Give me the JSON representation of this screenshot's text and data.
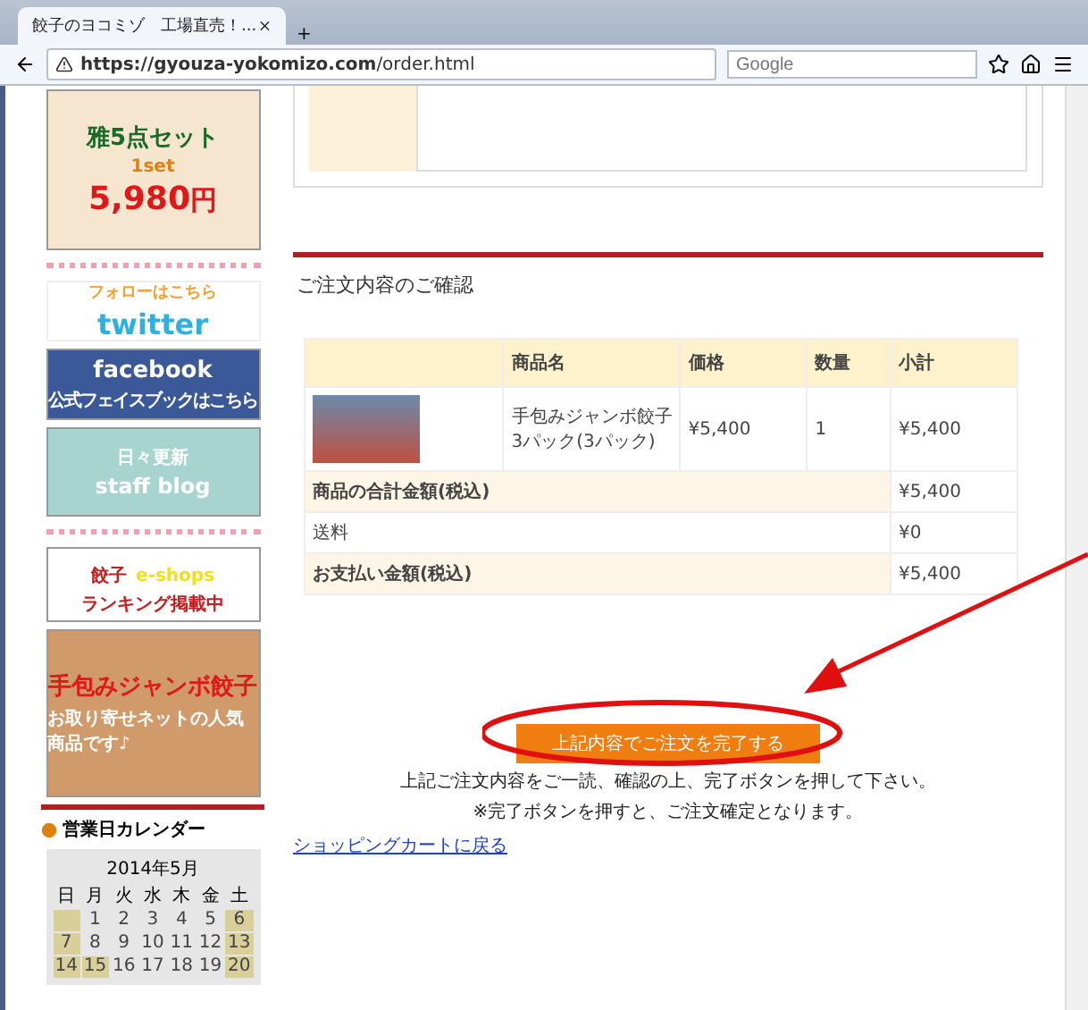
{
  "browser": {
    "tab_title": "餃子のヨコミゾ　工場直売！...",
    "new_tab": "+",
    "url_host": "https://gyouza-yokomizo.com",
    "url_path": "/order.html",
    "search_placeholder": "Google"
  },
  "sidebar": {
    "set_banner": {
      "title": "雅5点セット",
      "badge": "1set",
      "price": "5,980",
      "unit": "円"
    },
    "twitter": {
      "caption": "フォローはこちら",
      "name": "twitter"
    },
    "facebook": {
      "name": "facebook",
      "caption": "公式フェイスブックはこちら"
    },
    "blog": {
      "tag": "日々更新",
      "name": "staff blog"
    },
    "ranking": {
      "left": "餃子",
      "right": "e-shops",
      "caption": "ランキング掲載中"
    },
    "jumbo": {
      "title": "手包みジャンボ餃子",
      "note": "お取り寄せネットの人気商品です♪"
    },
    "calendar": {
      "heading": "営業日カレンダー",
      "month": "2014年5月",
      "weekdays": [
        "日",
        "月",
        "火",
        "水",
        "木",
        "金",
        "土"
      ],
      "weeks": [
        [
          {
            "holiday": true
          },
          {
            "day": "1",
            "holiday": false
          },
          {
            "day": "2",
            "holiday": false
          },
          {
            "day": "3",
            "holiday": false
          },
          {
            "day": "4",
            "holiday": false
          },
          {
            "day": "5",
            "holiday": false
          },
          {
            "day": "6",
            "holiday": true
          }
        ],
        [
          {
            "day": "7",
            "holiday": true
          },
          {
            "day": "8",
            "holiday": false
          },
          {
            "day": "9",
            "holiday": false
          },
          {
            "day": "10",
            "holiday": false
          },
          {
            "day": "11",
            "holiday": false
          },
          {
            "day": "12",
            "holiday": false
          },
          {
            "day": "13",
            "holiday": true
          }
        ],
        [
          {
            "day": "14",
            "holiday": true
          },
          {
            "day": "15",
            "holiday": true
          },
          {
            "day": "16",
            "holiday": false
          },
          {
            "day": "17",
            "holiday": false
          },
          {
            "day": "18",
            "holiday": false
          },
          {
            "day": "19",
            "holiday": false
          },
          {
            "day": "20",
            "holiday": true
          }
        ]
      ]
    }
  },
  "order": {
    "heading": "ご注文内容のご確認",
    "columns": [
      "商品名",
      "価格",
      "数量",
      "小計"
    ],
    "items": [
      {
        "name": "手包みジャンボ餃子3パック(3パック)",
        "price": "¥5,400",
        "quantity": "1",
        "subtotal": "¥5,400"
      }
    ],
    "totals": [
      {
        "label": "商品の合計金額(税込)",
        "value": "¥5,400",
        "emphasis": true
      },
      {
        "label": "送料",
        "value": "¥0",
        "emphasis": false
      },
      {
        "label": "お支払い金額(税込)",
        "value": "¥5,400",
        "emphasis": true
      }
    ],
    "submit": "上記内容でご注文を完了する",
    "notes": [
      "上記ご注文内容をご一読、確認の上、完了ボタンを押して下さい。",
      "※完了ボタンを押すと、ご注文確定となります。"
    ],
    "back_link": "ショッピングカートに戻る"
  }
}
